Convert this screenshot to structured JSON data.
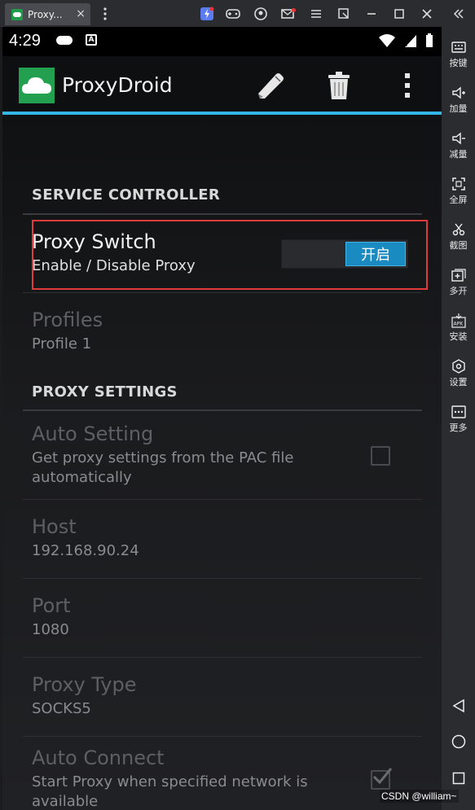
{
  "window": {
    "tab_title": "Proxy...",
    "tab_close": "×",
    "controls": [
      "icon-lightning",
      "gamepad-icon",
      "user-icon",
      "mail-icon",
      "menu-icon",
      "restore-icon",
      "minimize-icon",
      "maximize-icon",
      "close-icon",
      "collapse-icon"
    ]
  },
  "statusbar": {
    "time": "4:29",
    "a_badge": "A"
  },
  "actionbar": {
    "app_title": "ProxyDroid",
    "icons": [
      "pencil-icon",
      "trash-icon",
      "overflow-menu-icon"
    ]
  },
  "sections": {
    "service_controller": "SERVICE CONTROLLER",
    "proxy_settings": "PROXY SETTINGS"
  },
  "prefs": {
    "proxy_switch": {
      "title": "Proxy Switch",
      "summary": "Enable / Disable Proxy",
      "toggle_label": "开启",
      "enabled": true
    },
    "profiles": {
      "title": "Profiles",
      "summary": "Profile 1"
    },
    "auto_setting": {
      "title": "Auto Setting",
      "summary_line1": "Get proxy settings from the PAC file",
      "summary_line2": "automatically",
      "checked": false
    },
    "host": {
      "title": "Host",
      "summary": "192.168.90.24"
    },
    "port": {
      "title": "Port",
      "summary": "1080"
    },
    "proxy_type": {
      "title": "Proxy Type",
      "summary": "SOCKS5"
    },
    "auto_connect": {
      "title": "Auto Connect",
      "summary_line1": "Start Proxy when specified network is",
      "summary_line2": "available",
      "checked": true
    }
  },
  "rightbar": {
    "items": [
      {
        "label": "按键",
        "icon": "keyboard-icon"
      },
      {
        "label": "加量",
        "icon": "volume-up-icon"
      },
      {
        "label": "减量",
        "icon": "volume-down-icon"
      },
      {
        "label": "全屏",
        "icon": "fullscreen-icon"
      },
      {
        "label": "截图",
        "icon": "scissors-icon"
      },
      {
        "label": "多开",
        "icon": "multi-instance-icon"
      },
      {
        "label": "安装",
        "icon": "apk-icon"
      },
      {
        "label": "设置",
        "icon": "settings-icon"
      },
      {
        "label": "更多",
        "icon": "more-icon"
      }
    ],
    "nav": [
      "back-icon",
      "home-icon",
      "recents-icon"
    ]
  },
  "watermark": "CSDN @william~",
  "colors": {
    "accent_blue": "#33b5e5",
    "toggle_on": "#1a8bc0",
    "highlight_red": "#e03a3a",
    "app_green": "#22a04f"
  }
}
